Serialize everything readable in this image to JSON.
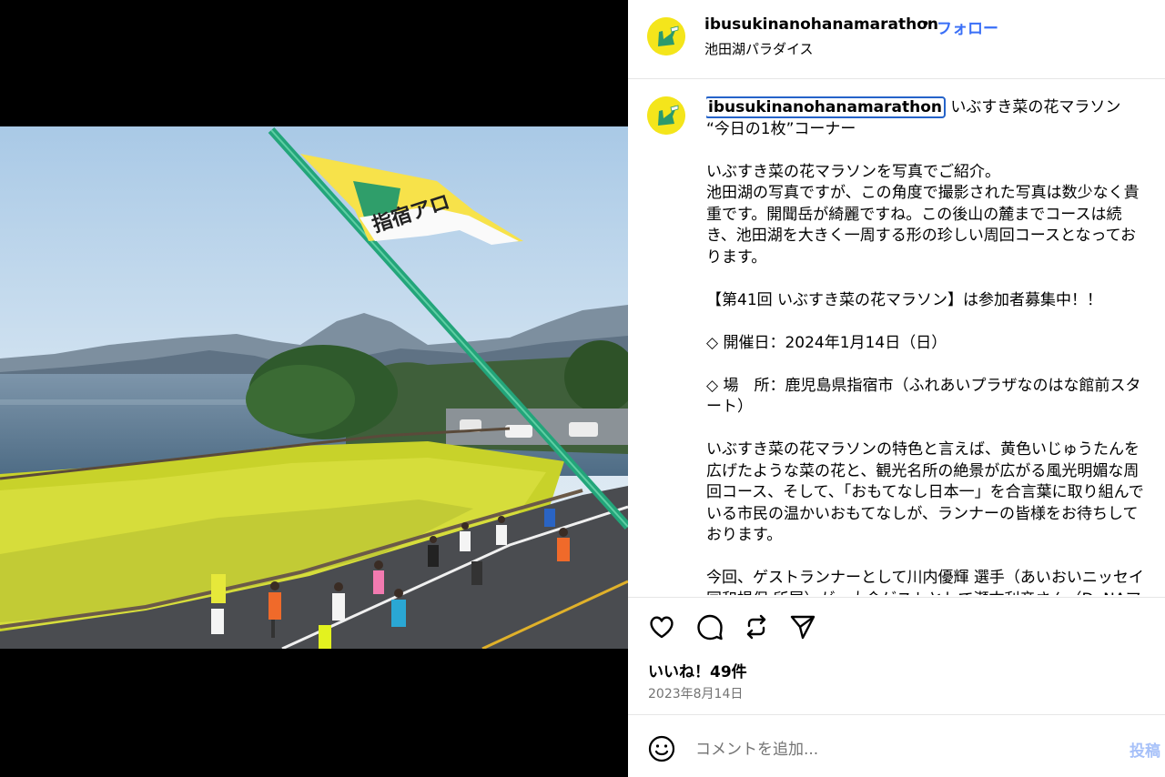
{
  "header": {
    "username": "ibusukinanohanamarathon",
    "dot": "•",
    "follow_label": "フォロー",
    "location": "池田湖パラダイス"
  },
  "photo": {
    "flag_text": "指宿アロ"
  },
  "caption": {
    "username": "ibusukinanohanamarathon",
    "text": " いぶすき菜の花マラソン\n“今日の1枚”コーナー\n\nいぶすき菜の花マラソンを写真でご紹介。\n池田湖の写真ですが、この角度で撮影された写真は数少なく貴\n重です。開聞岳が綺麗ですね。この後山の麓までコースは続\nき、池田湖を大きく一周する形の珍しい周回コースとなってお\nります。\n\n【第41回 いぶすき菜の花マラソン】は参加者募集中！！\n\n◇ 開催日：2024年1月14日（日）\n\n◇ 場　所：鹿児島県指宿市（ふれあいプラザなのはな館前スタ\nート）\n\nいぶすき菜の花マラソンの特色と言えば、黄色いじゅうたんを\n広げたような菜の花と、観光名所の絶景が広がる風光明媚な周\n回コース、そして、「おもてなし日本一」を合言葉に取り組んで\nいる市民の温かいおもてなしが、ランナーの皆様をお待ちして\nおります。\n\n今回、ゲストランナーとして川内優輝 選手（あいおいニッセイ\n同和損保 所属）が、大会ゲストとして瀬古利彦さん（DeNAア"
  },
  "actions": {
    "like_icon": "heart-icon",
    "comment_icon": "comment-bubble-icon",
    "share_icon": "repost-icon",
    "send_icon": "paper-plane-icon"
  },
  "likes_text": "いいね！49件",
  "date_text": "2023年8月14日",
  "comment": {
    "placeholder": "コメントを追加...",
    "post_label": "投稿"
  },
  "colors": {
    "follow_blue": "#3a6ff7",
    "post_disabled": "#a7c1f9",
    "avatar_yellow": "#f4e51b",
    "focus_outline": "#2563c9"
  }
}
